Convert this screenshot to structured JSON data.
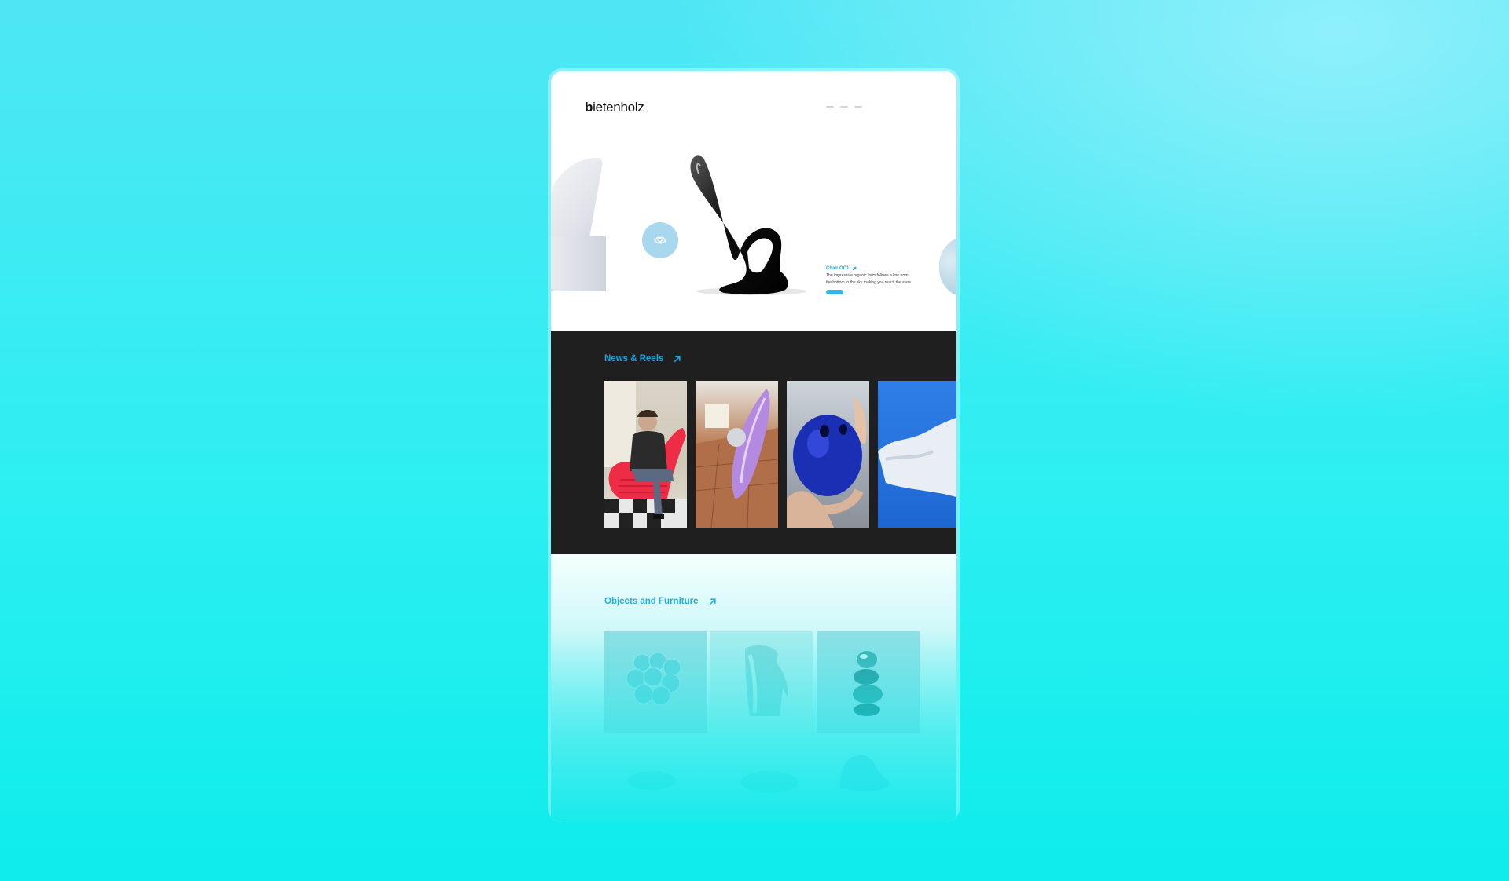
{
  "brand": {
    "logo_bold": "b",
    "logo_rest": "ietenholz"
  },
  "hero": {
    "product_title": "Chair OC1",
    "product_description": "The impressive organic form follows a line from the bottom to the sky making you reach the stars."
  },
  "news": {
    "title": "News & Reels"
  },
  "objects": {
    "title": "Objects and Furniture"
  },
  "colors": {
    "accent": "#1ba7e0",
    "dark_band": "#1f1f1f",
    "background": "#2deff2"
  },
  "icons": [
    "eye-icon",
    "arrow-up-right-icon"
  ]
}
